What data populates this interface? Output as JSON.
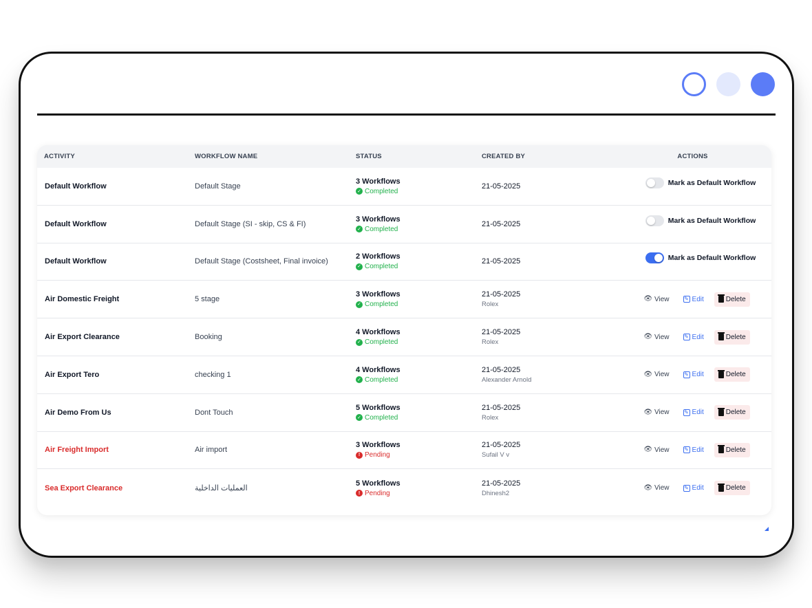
{
  "header": {
    "columns": [
      "ACTIVITY",
      "WORKFLOW NAME",
      "STATUS",
      "CREATED BY",
      "ACTIONS"
    ]
  },
  "labels": {
    "mark_default": "Mark as Default Workflow",
    "view": "View",
    "edit": "Edit",
    "delete": "Delete"
  },
  "rows": [
    {
      "activity": "Default Workflow",
      "workflow": "Default Stage",
      "count": "3 Workflows",
      "status": "Completed",
      "date": "21-05-2025",
      "creator": "",
      "action": "toggle",
      "toggle_on": false
    },
    {
      "activity": "Default Workflow",
      "workflow": "Default Stage (SI - skip, CS & FI)",
      "count": "3 Workflows",
      "status": "Completed",
      "date": "21-05-2025",
      "creator": "",
      "action": "toggle",
      "toggle_on": false
    },
    {
      "activity": "Default Workflow",
      "workflow": "Default Stage (Costsheet, Final invoice)",
      "count": "2 Workflows",
      "status": "Completed",
      "date": "21-05-2025",
      "creator": "",
      "action": "toggle",
      "toggle_on": true
    },
    {
      "activity": "Air Domestic Freight",
      "workflow": "5 stage",
      "count": "3 Workflows",
      "status": "Completed",
      "date": "21-05-2025",
      "creator": "Rolex",
      "action": "buttons"
    },
    {
      "activity": "Air Export Clearance",
      "workflow": "Booking",
      "count": "4 Workflows",
      "status": "Completed",
      "date": "21-05-2025",
      "creator": "Rolex",
      "action": "buttons"
    },
    {
      "activity": "Air Export Tero",
      "workflow": "checking 1",
      "count": "4 Workflows",
      "status": "Completed",
      "date": "21-05-2025",
      "creator": "Alexander Arnold",
      "action": "buttons"
    },
    {
      "activity": "Air Demo From Us",
      "workflow": "Dont Touch",
      "count": "5 Workflows",
      "status": "Completed",
      "date": "21-05-2025",
      "creator": "Rolex",
      "action": "buttons"
    },
    {
      "activity": "Air Freight Import",
      "workflow": "Air import",
      "count": "3 Workflows",
      "status": "Pending",
      "date": "21-05-2025",
      "creator": "Sufail V v",
      "action": "buttons",
      "highlight": true
    },
    {
      "activity": "Sea Export Clearance",
      "workflow": "العمليات الداخلية",
      "count": "5 Workflows",
      "status": "Pending",
      "date": "21-05-2025",
      "creator": "Dhinesh2",
      "action": "buttons",
      "highlight": true
    }
  ],
  "colors": {
    "accent": "#3b6ef0",
    "completed": "#22b14c",
    "pending": "#d92b2b"
  }
}
